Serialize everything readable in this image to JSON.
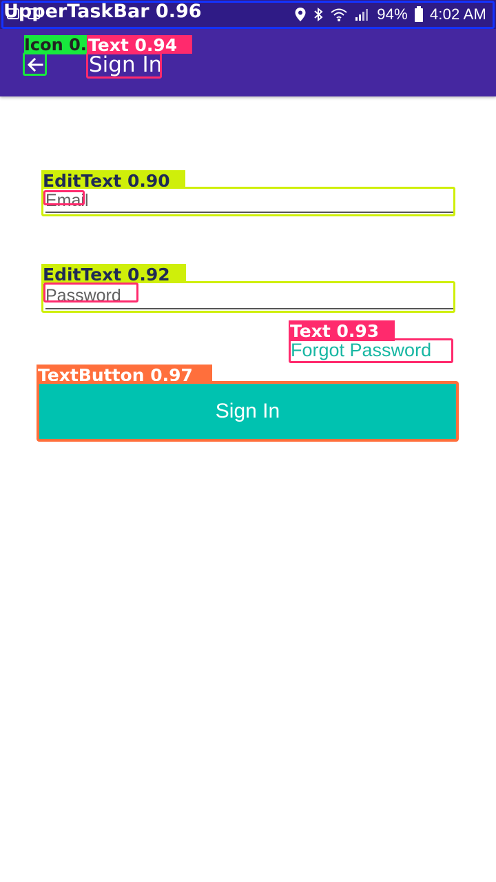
{
  "status_bar": {
    "battery": "94%",
    "time": "4:02 AM",
    "icons": [
      "location-icon",
      "bluetooth-icon",
      "wifi-icon",
      "signal-icon",
      "battery-icon"
    ]
  },
  "overlay_labels": {
    "upper_task_bar": "UpperTaskBar 0.96",
    "icon": "Icon 0.80",
    "title_text": "Text 0.94",
    "email_edit_text": "EditText 0.90",
    "password_edit_text": "EditText 0.92",
    "forgot_text": "Text 0.93",
    "text_button": "TextButton 0.97"
  },
  "app_bar": {
    "back_icon": "arrow-left-icon",
    "title": "Sign In"
  },
  "form": {
    "email_placeholder": "Email",
    "password_placeholder": "Password",
    "forgot_password": "Forgot Password",
    "sign_in_button": "Sign In"
  },
  "colors": {
    "status_bar": "#2f1b86",
    "app_bar": "#4527a0",
    "accent": "#00c2b0",
    "forgot_password_text": "#18b7a3"
  }
}
